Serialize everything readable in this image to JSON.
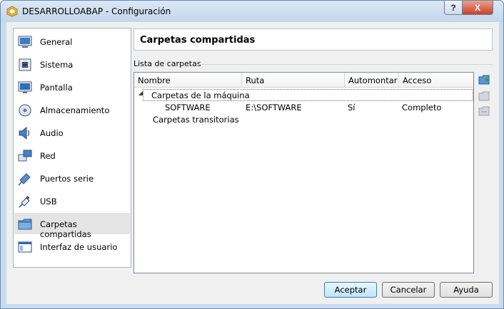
{
  "window": {
    "title": "DESARROLLOABAP - Configuración",
    "help_label": "?",
    "close_label": "X"
  },
  "sidebar": {
    "items": [
      {
        "label": "General",
        "icon": "general-monitor-icon"
      },
      {
        "label": "Sistema",
        "icon": "system-chip-icon"
      },
      {
        "label": "Pantalla",
        "icon": "display-monitor-icon"
      },
      {
        "label": "Almacenamiento",
        "icon": "storage-disk-icon"
      },
      {
        "label": "Audio",
        "icon": "speaker-icon"
      },
      {
        "label": "Red",
        "icon": "network-icon"
      },
      {
        "label": "Puertos serie",
        "icon": "serial-port-icon"
      },
      {
        "label": "USB",
        "icon": "usb-icon"
      },
      {
        "label": "Carpetas compartidas",
        "icon": "shared-folder-icon"
      },
      {
        "label": "Interfaz de usuario",
        "icon": "user-interface-icon"
      }
    ],
    "selected": "Carpetas compartidas"
  },
  "page": {
    "title": "Carpetas compartidas",
    "group_label": "Lista de carpetas"
  },
  "table": {
    "columns": [
      "Nombre",
      "Ruta",
      "Automontar",
      "Acceso"
    ],
    "groups": [
      {
        "label": "Carpetas de la máquina",
        "expander": "◢",
        "rows": [
          {
            "name": "SOFTWARE",
            "path": "E:\\SOFTWARE",
            "automount": "Sí",
            "access": "Completo"
          }
        ]
      },
      {
        "label": "Carpetas transitorias"
      }
    ]
  },
  "side_buttons": [
    "add-folder-icon",
    "edit-folder-icon",
    "remove-folder-icon"
  ],
  "buttons": {
    "ok": "Aceptar",
    "cancel": "Cancelar",
    "help": "Ayuda"
  }
}
